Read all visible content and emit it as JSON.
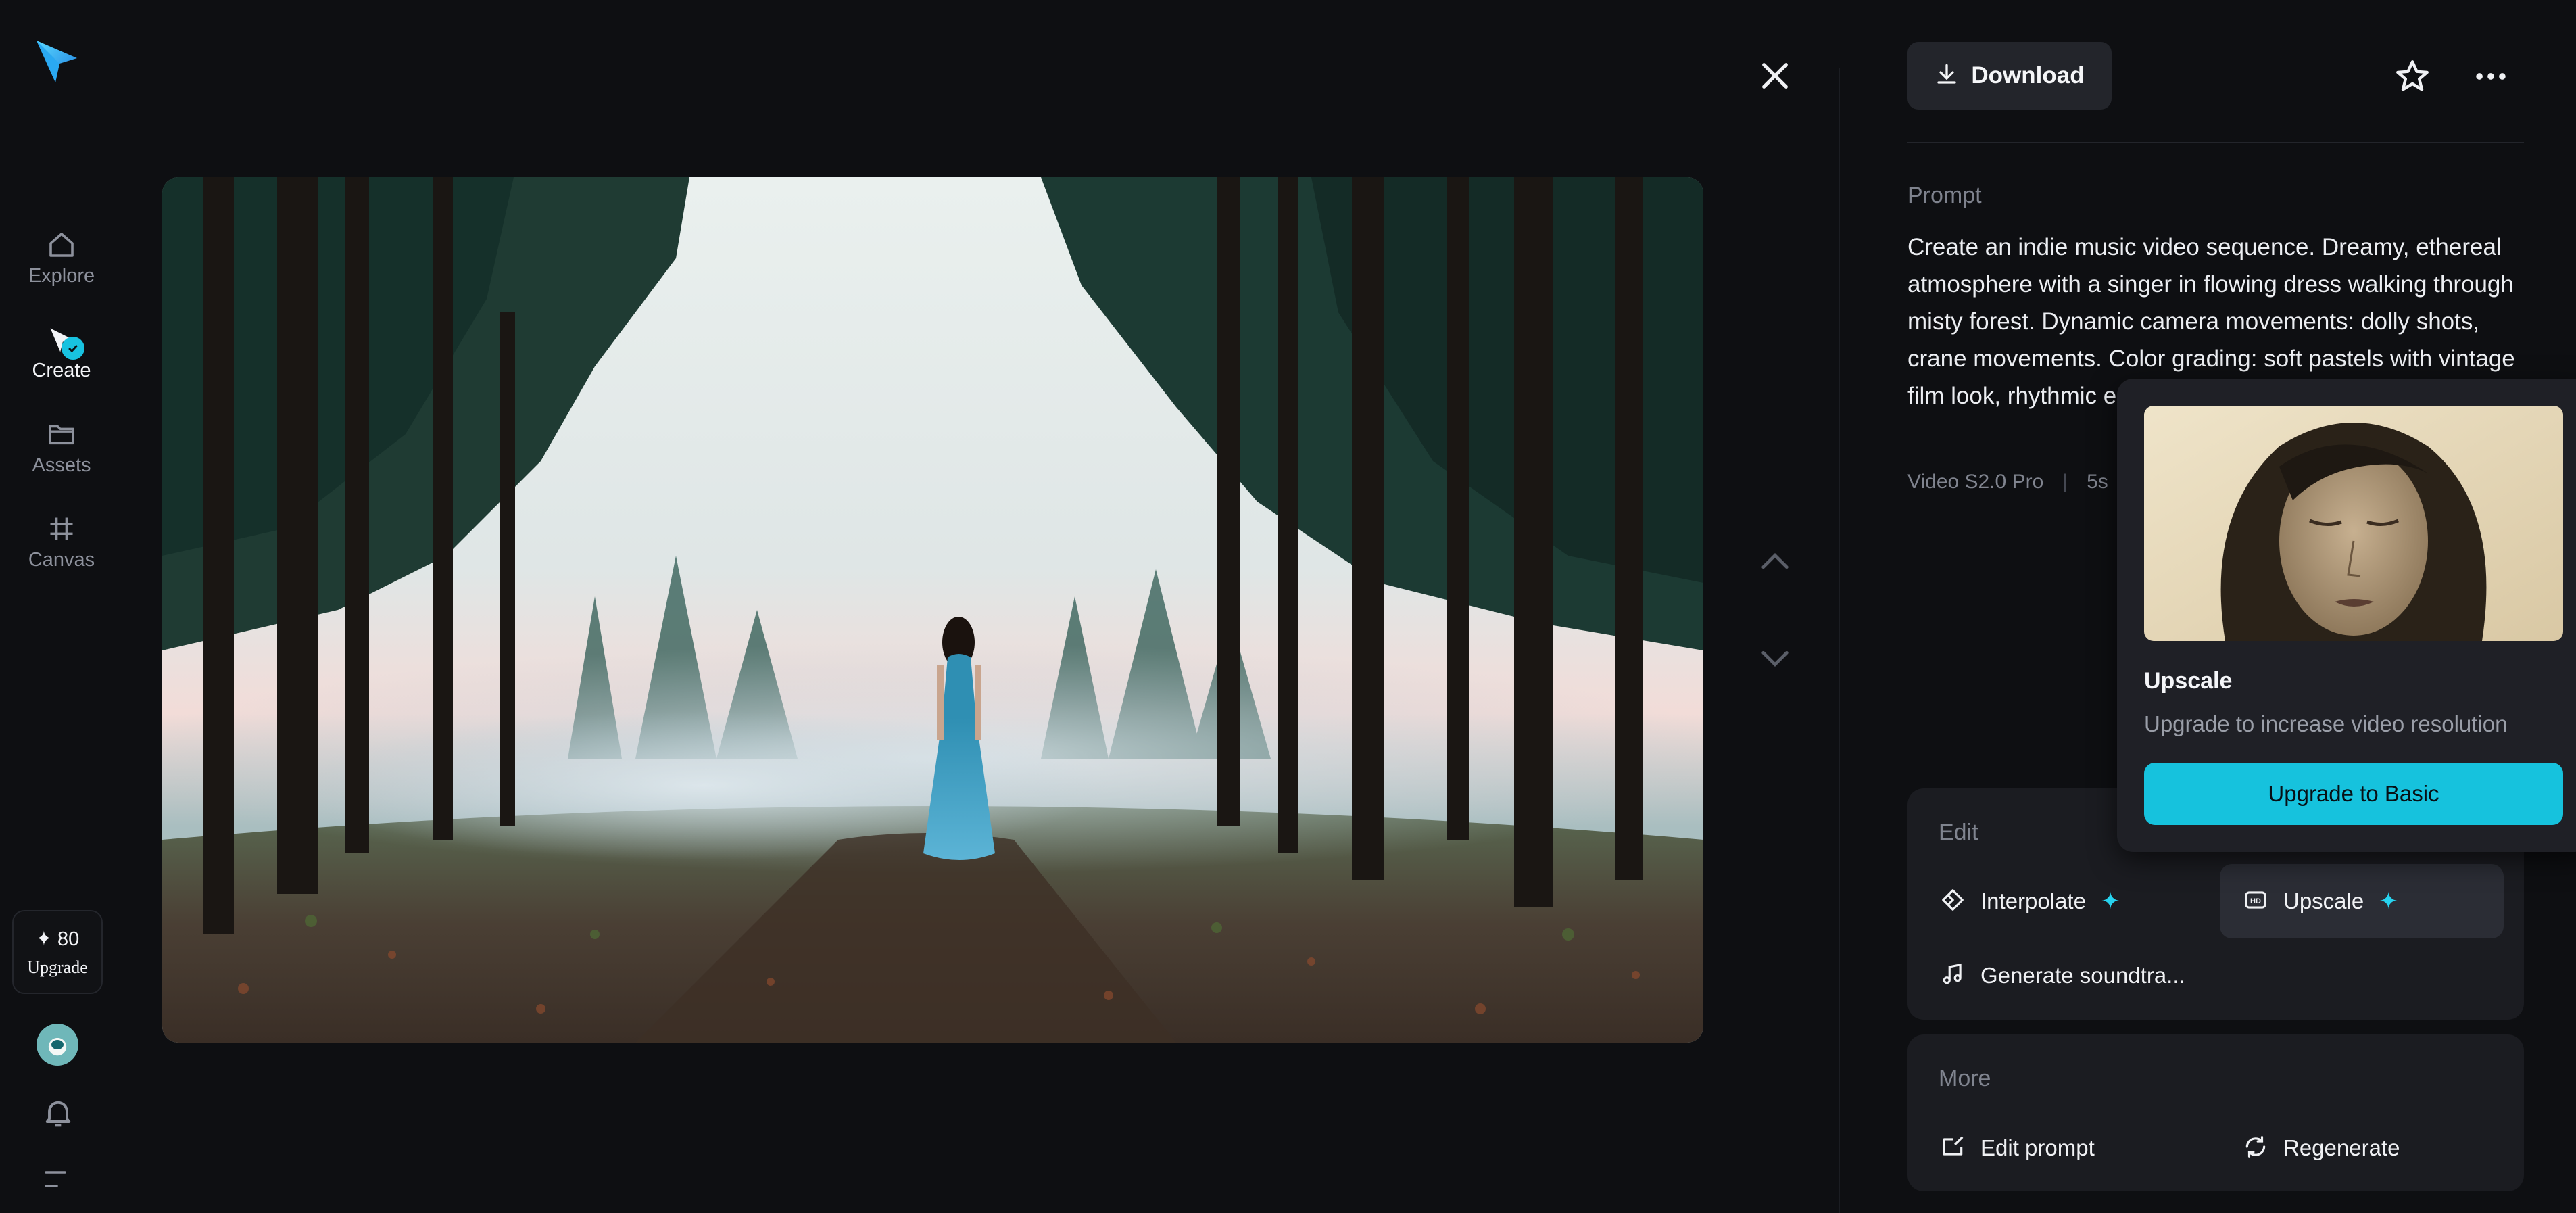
{
  "sidebar": {
    "items": [
      {
        "label": "Explore",
        "icon": "home-icon"
      },
      {
        "label": "Create",
        "icon": "create-icon",
        "active": true
      },
      {
        "label": "Assets",
        "icon": "folder-icon"
      },
      {
        "label": "Canvas",
        "icon": "canvas-icon"
      }
    ],
    "credits": "✦ 80",
    "upgrade_label": "Upgrade"
  },
  "header": {
    "download_label": "Download"
  },
  "prompt": {
    "label": "Prompt",
    "text": "Create an indie music video sequence. Dreamy, ethereal atmosphere with a singer in flowing dress walking through misty forest. Dynamic camera movements: dolly shots, crane movements. Color grading: soft pastels with vintage film look, rhythmic editing synced to music rhythm.",
    "model": "Video S2.0 Pro",
    "separator": "|",
    "duration": "5s"
  },
  "edit": {
    "title": "Edit",
    "tools": [
      {
        "label": "Interpolate",
        "icon": "interpolate-icon",
        "premium": "✦"
      },
      {
        "label": "Upscale",
        "icon": "hd-icon",
        "premium": "✦"
      },
      {
        "label": "Generate soundtra...",
        "icon": "music-note-icon"
      }
    ]
  },
  "more": {
    "title": "More",
    "tools": [
      {
        "label": "Edit prompt",
        "icon": "edit-prompt-icon"
      },
      {
        "label": "Regenerate",
        "icon": "regenerate-icon"
      }
    ]
  },
  "popup": {
    "title": "Upscale",
    "description": "Upgrade to increase video resolution",
    "button_label": "Upgrade to Basic"
  },
  "colors": {
    "background": "#0e0f12",
    "panel": "#1b1c21",
    "accent": "#16c2dd"
  }
}
